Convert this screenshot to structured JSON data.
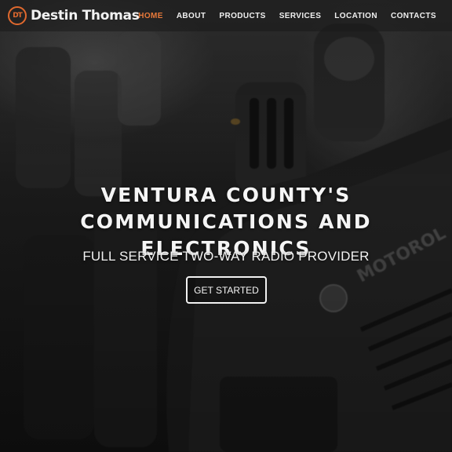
{
  "brand": {
    "mark": "DT",
    "name": "Destin Thomas",
    "accent_color": "#e8793a"
  },
  "nav": {
    "items": [
      {
        "label": "HOME",
        "active": true
      },
      {
        "label": "ABOUT",
        "active": false
      },
      {
        "label": "PRODUCTS",
        "active": false
      },
      {
        "label": "SERVICES",
        "active": false
      },
      {
        "label": "LOCATION",
        "active": false
      },
      {
        "label": "CONTACTS",
        "active": false
      }
    ]
  },
  "hero": {
    "headline_line1": "VENTURA COUNTY'S",
    "headline_line2": "COMMUNICATIONS AND ELECTRONICS",
    "subheadline": "FULL SERVICE TWO-WAY RADIO PROVIDER",
    "cta_label": "GET STARTED",
    "background": "radio-photo"
  }
}
